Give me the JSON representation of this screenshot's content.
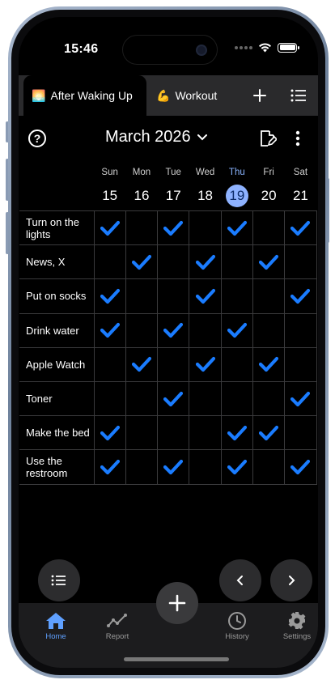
{
  "status": {
    "time": "15:46"
  },
  "tabs": [
    {
      "emoji": "🌅",
      "label": "After Waking Up",
      "active": true
    },
    {
      "emoji": "💪",
      "label": "Workout",
      "active": false
    }
  ],
  "header": {
    "help": "?",
    "month": "March 2026"
  },
  "days": [
    {
      "name": "Sun",
      "num": "15"
    },
    {
      "name": "Mon",
      "num": "16"
    },
    {
      "name": "Tue",
      "num": "17"
    },
    {
      "name": "Wed",
      "num": "18"
    },
    {
      "name": "Thu",
      "num": "19",
      "today": true
    },
    {
      "name": "Fri",
      "num": "20"
    },
    {
      "name": "Sat",
      "num": "21"
    }
  ],
  "habits": [
    {
      "label": "Turn on the lights",
      "checks": [
        1,
        0,
        1,
        0,
        1,
        0,
        1
      ]
    },
    {
      "label": "News, X",
      "checks": [
        0,
        1,
        0,
        1,
        0,
        1,
        0
      ]
    },
    {
      "label": "Put on socks",
      "checks": [
        1,
        0,
        0,
        1,
        0,
        0,
        1
      ]
    },
    {
      "label": "Drink water",
      "checks": [
        1,
        0,
        1,
        0,
        1,
        0,
        0
      ]
    },
    {
      "label": "Apple Watch",
      "checks": [
        0,
        1,
        0,
        1,
        0,
        1,
        0
      ]
    },
    {
      "label": "Toner",
      "checks": [
        0,
        0,
        1,
        0,
        0,
        0,
        1
      ]
    },
    {
      "label": "Make the bed",
      "checks": [
        1,
        0,
        0,
        0,
        1,
        1,
        0
      ]
    },
    {
      "label": "Use the restroom",
      "checks": [
        1,
        0,
        1,
        0,
        1,
        0,
        1
      ]
    }
  ],
  "nav": {
    "home": "Home",
    "report": "Report",
    "history": "History",
    "settings": "Settings"
  },
  "colors": {
    "accent": "#1a7cff",
    "today": "#8eb2ff",
    "nav_active": "#5fa0ff"
  }
}
